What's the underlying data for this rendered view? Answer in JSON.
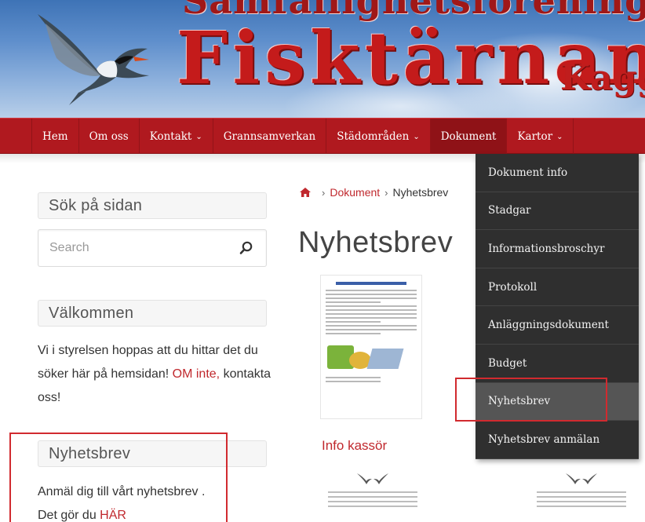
{
  "header": {
    "association_line": "Samfällighetsföreningen",
    "brand": "Fisktärnan",
    "brand_suffix": "Kagg"
  },
  "nav": {
    "items": [
      {
        "label": "Hem",
        "has_dropdown": false
      },
      {
        "label": "Om oss",
        "has_dropdown": false
      },
      {
        "label": "Kontakt",
        "has_dropdown": true
      },
      {
        "label": "Grannsamverkan",
        "has_dropdown": false
      },
      {
        "label": "Städområden",
        "has_dropdown": true
      },
      {
        "label": "Dokument",
        "has_dropdown": false,
        "active": true
      },
      {
        "label": "Kartor",
        "has_dropdown": true
      }
    ],
    "chevron": "⌄"
  },
  "dropdown": {
    "items": [
      "Dokument info",
      "Stadgar",
      "Informationsbroschyr",
      "Protokoll",
      "Anläggningsdokument",
      "Budget",
      "Nyhetsbrev",
      "Nyhetsbrev anmälan"
    ],
    "highlighted": "Nyhetsbrev"
  },
  "sidebar": {
    "search_title": "Sök på sidan",
    "search_placeholder": "Search",
    "welcome_title": "Välkommen",
    "welcome_text_1": "Vi i styrelsen hoppas att du hittar det du söker här på hemsidan! ",
    "welcome_link": "OM inte,",
    "welcome_text_2": " kontakta oss!",
    "news_title": "Nyhetsbrev",
    "news_text_1": "Anmäl dig till vårt nyhetsbrev .",
    "news_text_2": "Det gör du ",
    "news_link": "HÄR"
  },
  "main": {
    "breadcrumb": {
      "home_icon": "home-icon",
      "separator": "›",
      "link": "Dokument",
      "current": "Nyhetsbrev"
    },
    "title": "Nyhetsbrev",
    "section_link": "Info kassör"
  },
  "colors": {
    "nav_red": "#b0191f",
    "accent_red": "#c0282d",
    "dropdown_bg": "#2f2f2f",
    "highlight_box": "#d12a2f"
  }
}
